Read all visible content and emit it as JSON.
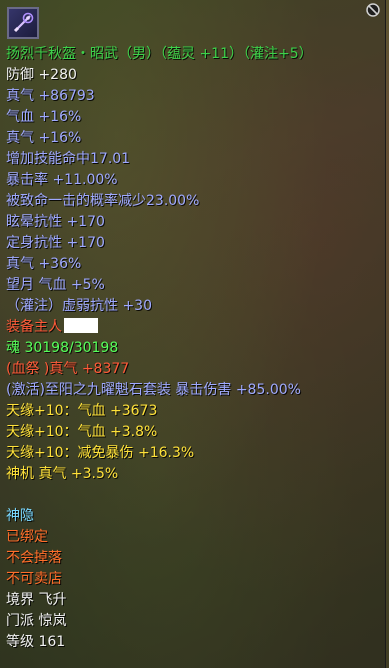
{
  "item": {
    "title": "扬烈千秋盔・昭武（男）（蕴灵 +11）（灌注+5）"
  },
  "stats": [
    {
      "id": "defense",
      "text": "防御 +280"
    },
    {
      "id": "zhenqi1",
      "text": "真气 +86793"
    },
    {
      "id": "qixue1",
      "text": "气血 +16%"
    },
    {
      "id": "zhenqi2",
      "text": "真气 +16%"
    },
    {
      "id": "skill_hit",
      "text": "增加技能命中17.01"
    },
    {
      "id": "crit",
      "text": "暴击率 +11.00%"
    },
    {
      "id": "crit_reduce",
      "text": "被致命一击的概率减少23.00%"
    },
    {
      "id": "stun_res",
      "text": "眩晕抗性 +170"
    },
    {
      "id": "root_res",
      "text": "定身抗性 +170"
    },
    {
      "id": "zhenqi3",
      "text": "真气 +36%"
    },
    {
      "id": "wangyue",
      "text": "望月 气血 +5%"
    },
    {
      "id": "weak_res",
      "text": "（灌注）虚弱抗性 +30"
    }
  ],
  "owner_label": "装备主人",
  "soul": "魂 30198/30198",
  "blood": "(血祭 )真气 +8377",
  "set_bonus": "(激活)至阳之九曜魁石套装 暴击伤害 +85.00%",
  "tianyuan": [
    {
      "id": "ty1",
      "text": "天缘+10：气血 +3673"
    },
    {
      "id": "ty2",
      "text": "天缘+10：气血 +3.8%"
    },
    {
      "id": "ty3",
      "text": "天缘+10：减免暴伤 +16.3%"
    }
  ],
  "shenji": "神机 真气 +3.5%",
  "shenyin": "神隐",
  "bound": "已绑定",
  "no_drop": "不会掉落",
  "no_sell": "不可卖店",
  "realm": "境界 飞升",
  "sect": "门派 惊岚",
  "level": "等级 161"
}
